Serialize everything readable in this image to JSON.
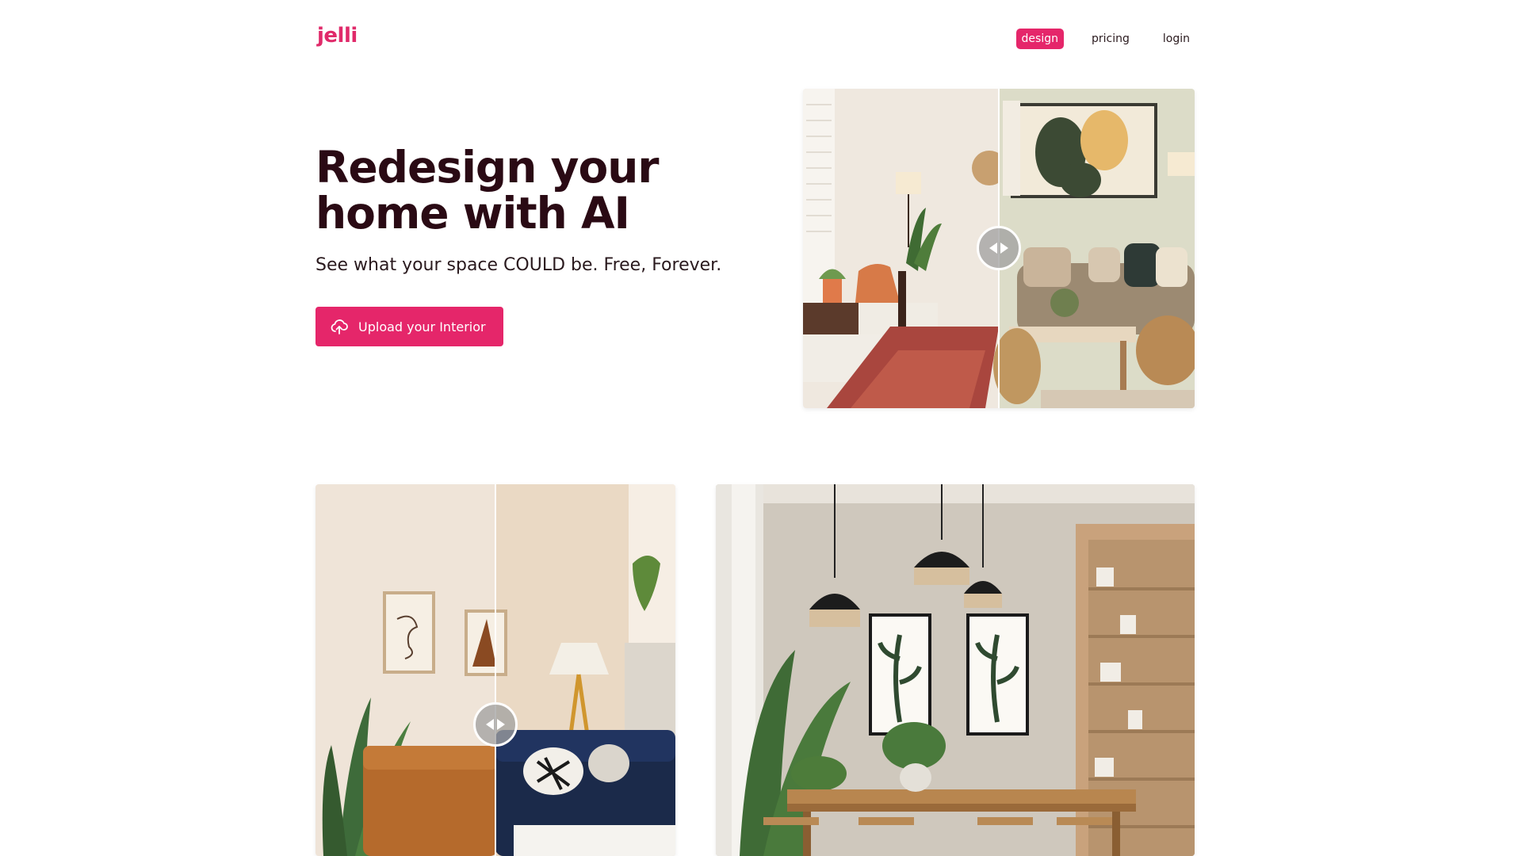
{
  "brand": {
    "logo_text": "jelli",
    "accent": "#e5266a",
    "title_color": "#2a0a14"
  },
  "nav": {
    "items": [
      {
        "label": "design",
        "active": true
      },
      {
        "label": "pricing",
        "active": false
      },
      {
        "label": "login",
        "active": false
      }
    ]
  },
  "hero": {
    "title": "Redesign your home with AI",
    "subtitle": "See what your space COULD be. Free, Forever.",
    "cta_label": "Upload your Interior",
    "cta_icon": "cloud-upload-icon"
  },
  "gallery": [
    {
      "kind": "before-after-comparison",
      "slider_position": 0.5
    },
    {
      "kind": "before-after-comparison",
      "slider_position": 0.5
    },
    {
      "kind": "single-render"
    }
  ]
}
